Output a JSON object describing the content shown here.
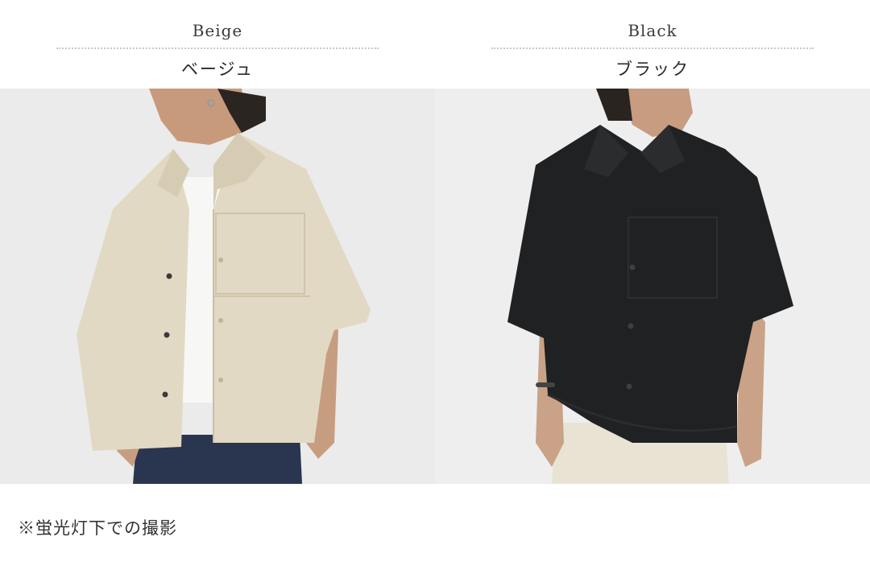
{
  "variants": [
    {
      "name_en": "Beige",
      "name_ja": "ベージュ"
    },
    {
      "name_en": "Black",
      "name_ja": "ブラック"
    }
  ],
  "note": "※蛍光灯下での撮影",
  "colors": {
    "beige_shirt": "#e2d9c4",
    "black_shirt": "#1f2123",
    "background_light": "#ebebeb"
  }
}
